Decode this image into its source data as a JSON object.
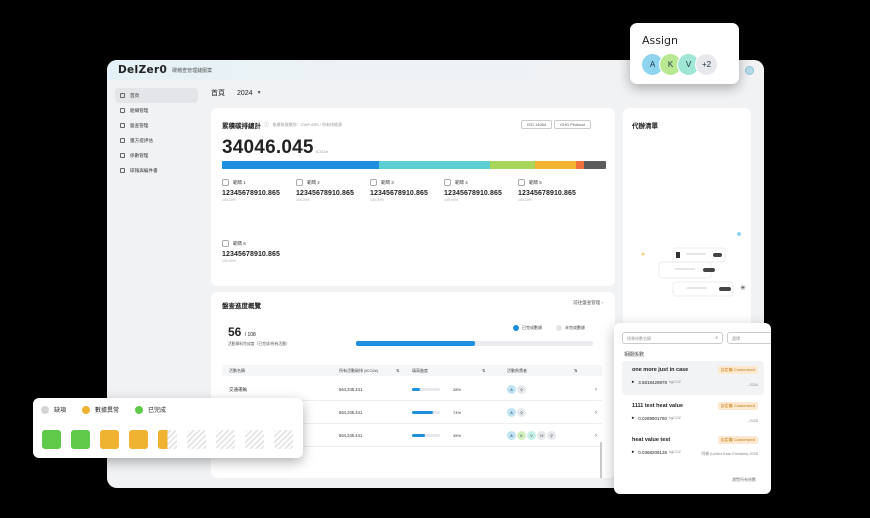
{
  "app": {
    "logo": "DeIZer0",
    "subtitle": "碳稽查管理鏈服案",
    "user_initial": ""
  },
  "sidebar": {
    "items": [
      {
        "label": "首頁",
        "icon": "home-icon"
      },
      {
        "label": "組織管理",
        "icon": "org-icon"
      },
      {
        "label": "盤查管理",
        "icon": "inventory-icon"
      },
      {
        "label": "獲方提評估",
        "icon": "assess-icon"
      },
      {
        "label": "係數管理",
        "icon": "factor-icon"
      },
      {
        "label": "碳報與編件書",
        "icon": "report-icon"
      }
    ]
  },
  "breadcrumb": {
    "home": "首頁",
    "year": "2024"
  },
  "emissions": {
    "title": "累積碳排總計",
    "subtitle": "依據排放類別：GWP AR5 / 所有排放源",
    "tags": [
      "ISO 14064",
      "GHG Protocol"
    ],
    "total": "34046.045",
    "unit": "tCO2e",
    "segments": [
      {
        "color": "#1f8fe0",
        "share": 0.42
      },
      {
        "color": "#5bcfd2",
        "share": 0.3
      },
      {
        "color": "#a8d65a",
        "share": 0.12
      },
      {
        "color": "#f0b231",
        "share": 0.11
      },
      {
        "color": "#f06f3c",
        "share": 0.02
      },
      {
        "color": "#5b5b5b",
        "share": 0.06
      }
    ],
    "scopes": [
      {
        "label": "範疇 1",
        "value": "12345678910.865",
        "sub": "100.00%"
      },
      {
        "label": "範疇 2",
        "value": "12345678910.865",
        "sub": "100.00%"
      },
      {
        "label": "範疇 3",
        "value": "12345678910.865",
        "sub": "100.00%"
      },
      {
        "label": "範疇 4",
        "value": "12345678910.865",
        "sub": "100.00%"
      },
      {
        "label": "範疇 5",
        "value": "12345678910.865",
        "sub": "100.00%"
      },
      {
        "label": "範疇 6",
        "value": "12345678910.865",
        "sub": "100.00%"
      }
    ]
  },
  "progress": {
    "title": "盤查進度概覽",
    "link": "前往盤查管理",
    "done": "56",
    "total": "/ 108",
    "label": "活動資料完成度（已完成/所有活動）",
    "fraction": 0.5,
    "legend": [
      {
        "label": "已完成數據",
        "color": "#1f8fe0"
      },
      {
        "label": "未完成數據",
        "color": "#e3e5e8"
      }
    ],
    "columns": [
      "活動名稱",
      "所有活動碳排 (tCO2e)",
      "填寫進度",
      "活動負責者"
    ],
    "rows": [
      {
        "name": "交通運輸",
        "value": "564,345.441",
        "pct": "28%",
        "fill": 0.28,
        "avatars": [
          "A",
          "A"
        ]
      },
      {
        "name": "",
        "value": "564,345.441",
        "pct": "74%",
        "fill": 0.74,
        "avatars": [
          "A",
          "A"
        ]
      },
      {
        "name": "",
        "value": "564,345.441",
        "pct": "45%",
        "fill": 0.45,
        "avatars": [
          "A",
          "K",
          "V",
          "+2"
        ]
      }
    ]
  },
  "todo": {
    "title": "代辦清單"
  },
  "factor_panel": {
    "search_placeholder": "搜尋係數名稱",
    "select_placeholder": "選擇",
    "title": "相關係數",
    "items": [
      {
        "name": "one more just in case",
        "value": "3.5818429878",
        "unit": "kgCO2",
        "badge": "自定義 Customized",
        "year": "- 2024"
      },
      {
        "name": "1111 test heat value",
        "value": "0.0289901760",
        "unit": "kgCO2",
        "badge": "自定義 Customized",
        "year": "- 2025"
      },
      {
        "name": "heat value test",
        "value": "0.0368208126",
        "unit": "kgCO2",
        "badge": "自定義 Customized",
        "year": "阿聯 (United Arab Emirates) 2025"
      }
    ],
    "more": "瀏覽所有係數"
  },
  "assign": {
    "title": "Assign",
    "avatars": [
      {
        "initial": "A",
        "color": "#8fd4ef"
      },
      {
        "initial": "K",
        "color": "#b8e892"
      },
      {
        "initial": "V",
        "color": "#9fe6d4"
      },
      {
        "initial": "+2",
        "color": "#e7e9ec"
      }
    ]
  },
  "status": {
    "legend": [
      {
        "label": "缺項",
        "color": "#d4d4d4"
      },
      {
        "label": "數據異常",
        "color": "#f0b231"
      },
      {
        "label": "已完成",
        "color": "#5fc94a"
      }
    ],
    "boxes": [
      "done",
      "done",
      "warn",
      "warn",
      "half",
      "empty",
      "empty",
      "empty",
      "empty"
    ]
  }
}
